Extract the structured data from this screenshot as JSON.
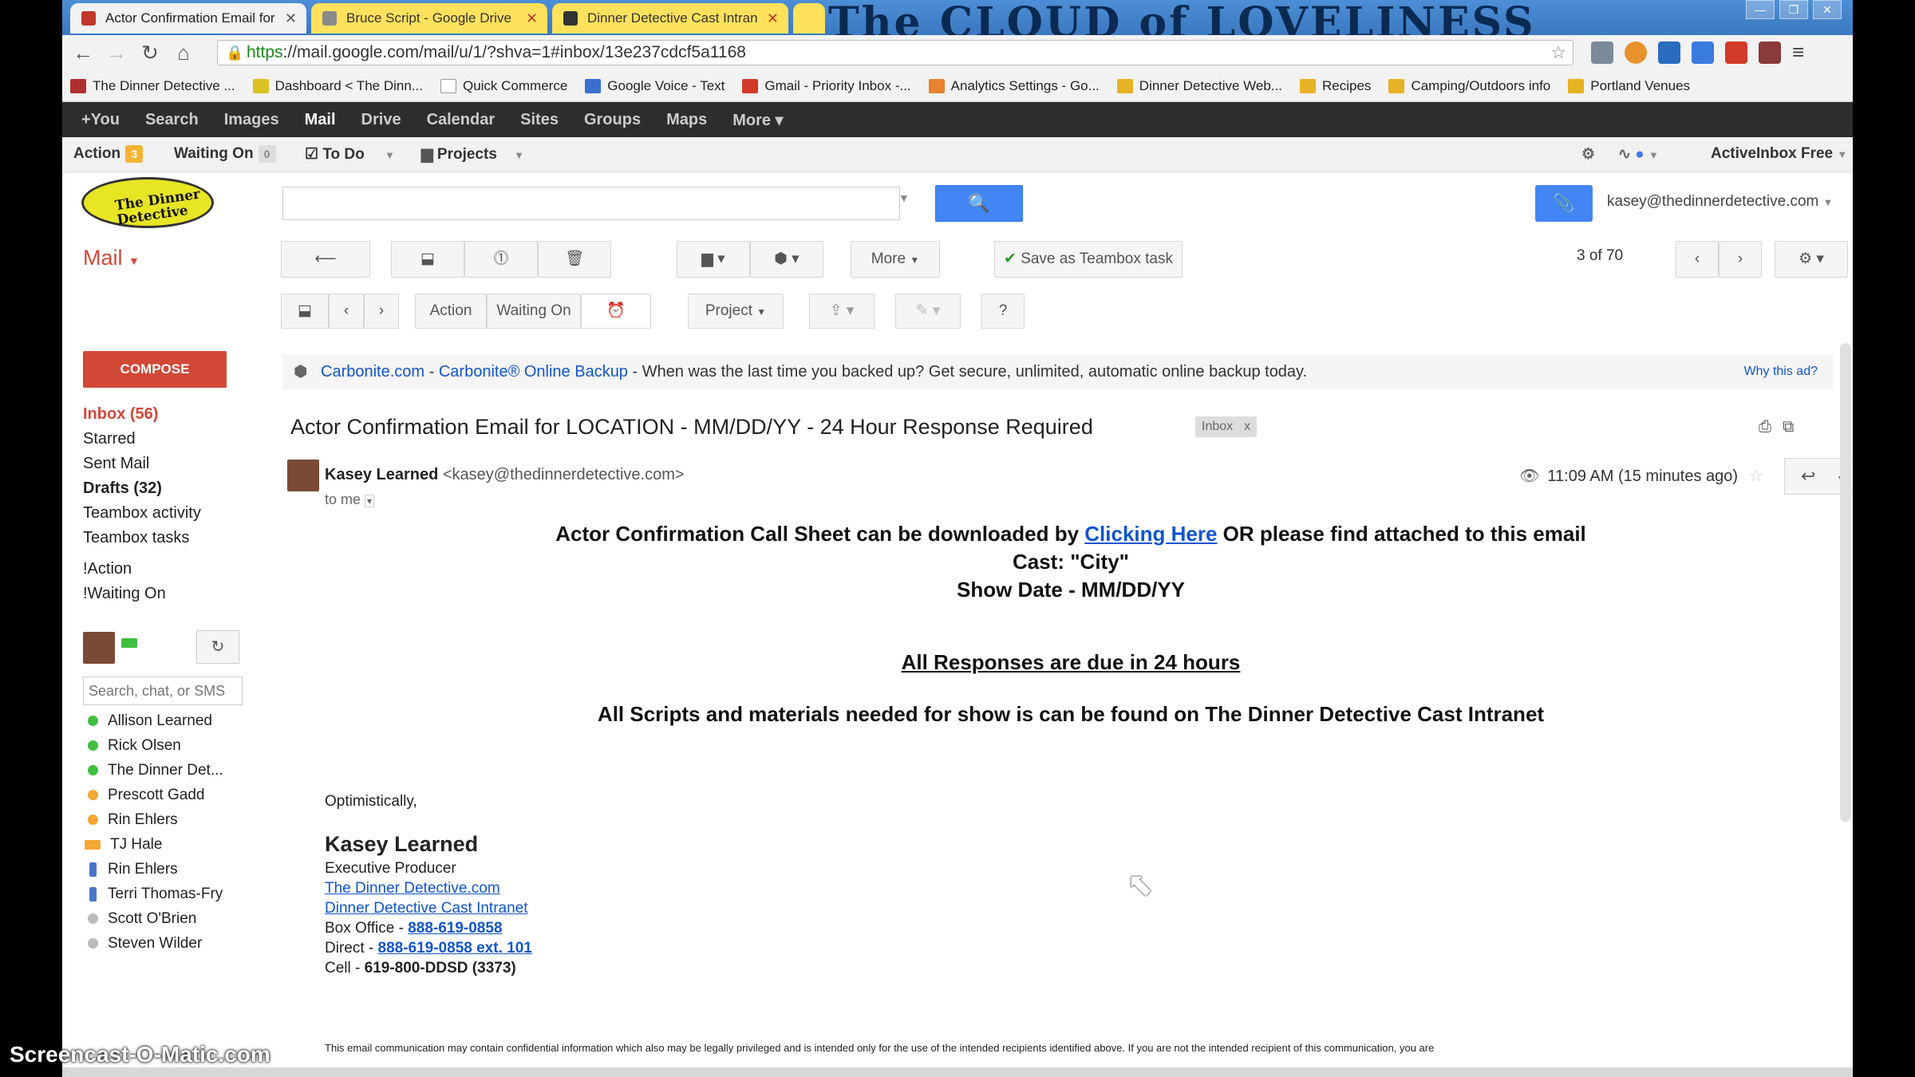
{
  "browser": {
    "tabs": [
      {
        "label": "Actor Confirmation Email for",
        "color": "#f2f2f2"
      },
      {
        "label": "Bruce Script - Google Drive",
        "color": "#ffe15c"
      },
      {
        "label": "Dinner Detective Cast Intran",
        "color": "#ffe15c"
      }
    ],
    "banner_text": "The CLOUD of LOVELINESS",
    "url_scheme": "https",
    "url_rest": "://mail.google.com/mail/u/1/?shva=1#inbox/13e237cdcf5a1168"
  },
  "bookmarks": [
    {
      "label": "The Dinner Detective ...",
      "icon": "theater-icon"
    },
    {
      "label": "Dashboard < The Dinn...",
      "icon": "dashboard-icon"
    },
    {
      "label": "Quick Commerce",
      "icon": "page-icon"
    },
    {
      "label": "Google Voice - Text",
      "icon": "phone-icon"
    },
    {
      "label": "Gmail - Priority Inbox -...",
      "icon": "gmail-icon"
    },
    {
      "label": "Analytics Settings - Go...",
      "icon": "analytics-icon"
    },
    {
      "label": "Dinner Detective Web...",
      "icon": "folder-icon"
    },
    {
      "label": "Recipes",
      "icon": "folder-icon"
    },
    {
      "label": "Camping/Outdoors info",
      "icon": "folder-icon"
    },
    {
      "label": "Portland Venues",
      "icon": "folder-icon"
    }
  ],
  "gbar": {
    "items": [
      "+You",
      "Search",
      "Images",
      "Mail",
      "Drive",
      "Calendar",
      "Sites",
      "Groups",
      "Maps",
      "More ▾"
    ]
  },
  "activeinbox": {
    "action": "Action",
    "action_count": "3",
    "waiting": "Waiting On",
    "waiting_count": "0",
    "todo": "To Do",
    "projects": "Projects",
    "brand": "ActiveInbox Free"
  },
  "logo_text": "The Dinner Detective",
  "account_email": "kasey@thedinnerdetective.com",
  "mail_label": "Mail",
  "toolbar": {
    "more": "More",
    "teambox": "Save as Teambox task",
    "pager": "3 of 70",
    "action": "Action",
    "waiting_on": "Waiting On",
    "project": "Project"
  },
  "sidebar": {
    "compose": "COMPOSE",
    "folders": [
      {
        "label": "Inbox (56)",
        "style": "inbox"
      },
      {
        "label": "Starred",
        "style": ""
      },
      {
        "label": "Sent Mail",
        "style": ""
      },
      {
        "label": "Drafts (32)",
        "style": "bold"
      },
      {
        "label": "Teambox activity",
        "style": ""
      },
      {
        "label": "Teambox tasks",
        "style": ""
      },
      {
        "label": "!Action",
        "style": "gap"
      },
      {
        "label": "!Waiting On",
        "style": ""
      }
    ],
    "chat_search_placeholder": "Search, chat, or SMS",
    "contacts": [
      {
        "name": "Allison Learned",
        "status": "green"
      },
      {
        "name": "Rick Olsen",
        "status": "green"
      },
      {
        "name": "The Dinner Det...",
        "status": "green"
      },
      {
        "name": "Prescott Gadd",
        "status": "orange"
      },
      {
        "name": "Rin Ehlers",
        "status": "orange"
      },
      {
        "name": "TJ Hale",
        "status": "video"
      },
      {
        "name": "Rin Ehlers",
        "status": "phone"
      },
      {
        "name": "Terri Thomas-Fry",
        "status": "phone"
      },
      {
        "name": "Scott O'Brien",
        "status": "grey"
      },
      {
        "name": "Steven Wilder",
        "status": "grey"
      }
    ]
  },
  "ad": {
    "sponsor": "Carbonite.com",
    "sep1": " - ",
    "title": "Carbonite® Online Backup",
    "text": " - When was the last time you backed up? Get secure, unlimited, automatic online backup today.",
    "why": "Why this ad?"
  },
  "message": {
    "subject": "Actor Confirmation Email for LOCATION - MM/DD/YY - 24 Hour Response Required",
    "label": "Inbox",
    "sender_name": "Kasey Learned",
    "sender_email": "<kasey@thedinnerdetective.com>",
    "to": "to me",
    "time": "11:09 AM (15 minutes ago)",
    "line1_pre": "Actor Confirmation Call Sheet can be downloaded by ",
    "line1_link": "Clicking Here",
    "line1_post": " OR please find attached to this email",
    "line2": "Cast: \"City\"",
    "line3": "Show Date - MM/DD/YY",
    "responses": "All Responses are due in 24 hours",
    "scripts": "All Scripts and materials needed for show is can be found on The Dinner Detective Cast Intranet",
    "closing": "Optimistically,",
    "sig_name": "Kasey Learned",
    "sig_title": "Executive Producer",
    "sig_link1": "The Dinner Detective.com",
    "sig_link2": "Dinner Detective Cast Intranet",
    "box_office_label": "Box Office - ",
    "box_office": "888-619-0858",
    "direct_label": "Direct - ",
    "direct": "888-619-0858 ext. 101",
    "cell_label": "Cell - ",
    "cell": "619-800-DDSD (3373)",
    "disclaimer": "This email communication may contain confidential information which also may be legally privileged and is intended only for the use of the intended recipients identified above. If you are not the intended recipient of this communication, you are"
  },
  "watermark": "Screencast-O-Matic.com",
  "colors": {
    "gmail_red": "#d14836",
    "link_blue": "#1155cc",
    "search_blue": "#4285f4"
  }
}
